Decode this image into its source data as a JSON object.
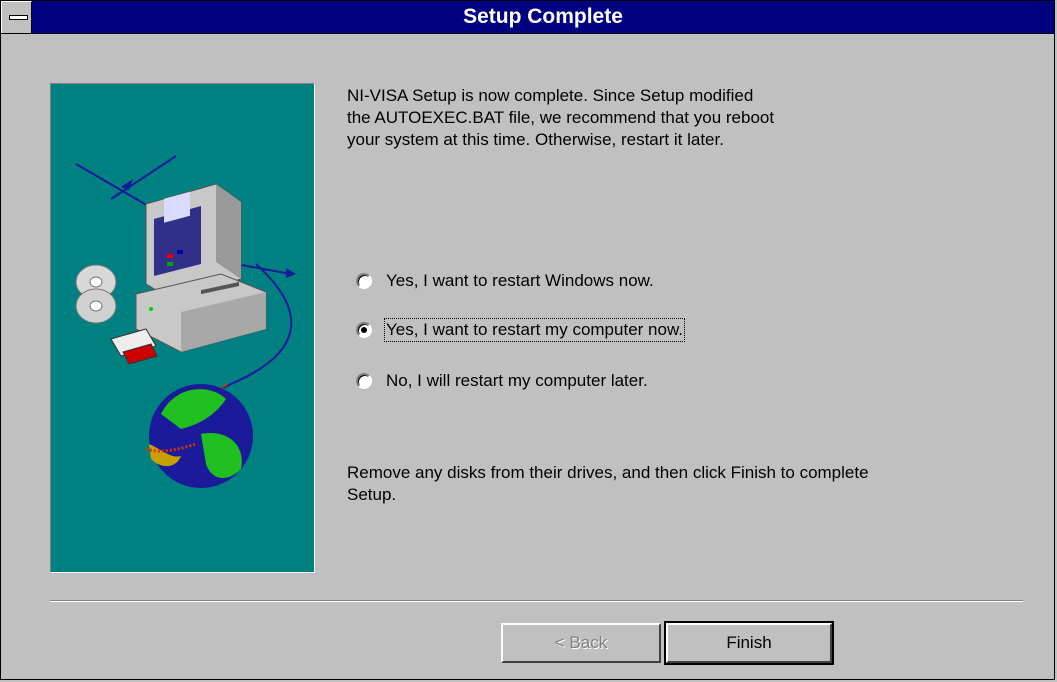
{
  "window": {
    "title": "Setup Complete"
  },
  "message_top": "NI-VISA Setup is now complete.  Since Setup modified\nthe AUTOEXEC.BAT file, we recommend that you reboot\nyour system at this time.  Otherwise, restart it later.",
  "options": [
    {
      "label": "Yes, I want to restart Windows now.",
      "selected": false
    },
    {
      "label": "Yes, I want to restart my computer now.",
      "selected": true
    },
    {
      "label": "No, I will restart my computer later.",
      "selected": false
    }
  ],
  "message_bottom": "Remove any disks from their drives, and then click Finish to complete\nSetup.",
  "buttons": {
    "back_label": "< Back",
    "finish_label": "Finish"
  },
  "colors": {
    "titlebar": "#000080",
    "dialog": "#c0c0c0",
    "art_background": "#008080"
  }
}
